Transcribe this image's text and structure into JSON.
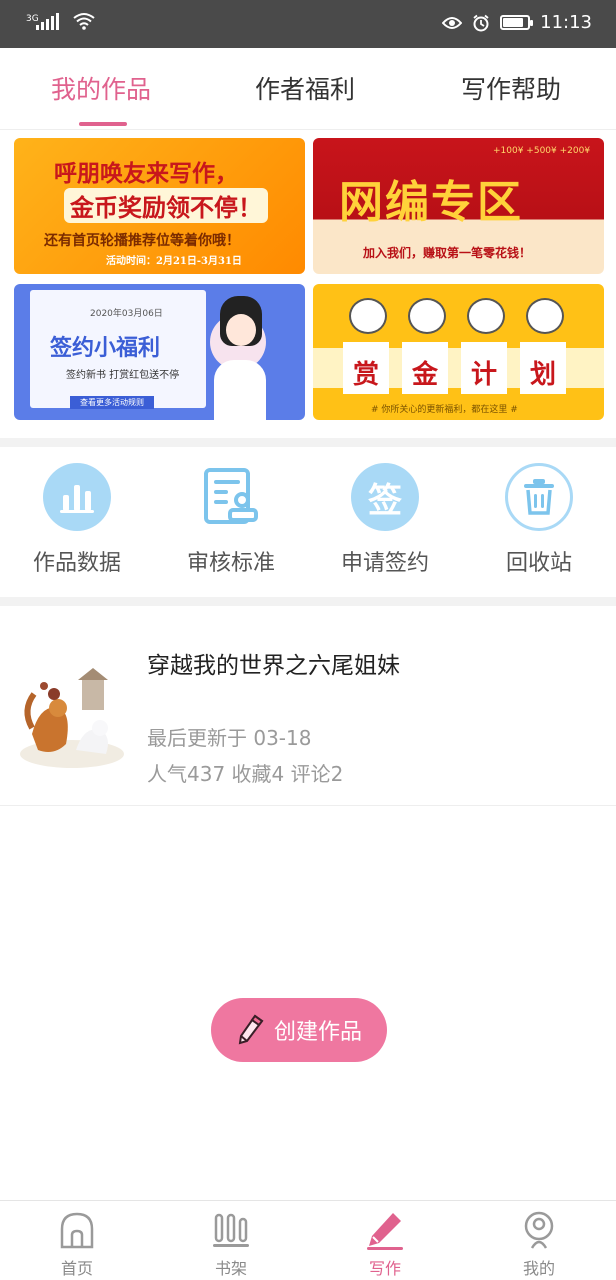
{
  "status_bar": {
    "network": "3G",
    "time": "11:13",
    "battery_level": 0.85
  },
  "tabs": [
    {
      "label": "我的作品",
      "active": true
    },
    {
      "label": "作者福利",
      "active": false
    },
    {
      "label": "写作帮助",
      "active": false
    }
  ],
  "banners": [
    {
      "line1": "呼朋唤友来写作，",
      "line2": "金币奖励领不停！",
      "line3": "还有首页轮播推荐位等着你哦！",
      "note": "活动时间：2月21日-3月31日"
    },
    {
      "title": "网编专区",
      "note": "加入我们，赚取第一笔零花钱！",
      "tags": "+100¥  +500¥  +200¥"
    },
    {
      "date": "2020年03月06日",
      "title": "签约小福利",
      "sub": "签约新书  打赏红包送不停",
      "link": "查看更多活动规则"
    },
    {
      "chars": [
        "赏",
        "金",
        "计",
        "划"
      ],
      "note": "# 你所关心的更新福利，都在这里 #"
    }
  ],
  "tools": [
    {
      "label": "作品数据",
      "icon": "bar-chart-icon"
    },
    {
      "label": "审核标准",
      "icon": "review-doc-icon"
    },
    {
      "label": "申请签约",
      "icon": "sign-icon"
    },
    {
      "label": "回收站",
      "icon": "trash-icon"
    }
  ],
  "tool_sign_glyph": "签",
  "work": {
    "title": "穿越我的世界之六尾姐妹",
    "updated": "最后更新于 03-18",
    "stats": "人气437  收藏4  评论2"
  },
  "create_button": {
    "label": "创建作品"
  },
  "bottom_nav": [
    {
      "label": "首页",
      "icon": "home-icon",
      "active": false
    },
    {
      "label": "书架",
      "icon": "bookshelf-icon",
      "active": false
    },
    {
      "label": "写作",
      "icon": "pen-icon",
      "active": true
    },
    {
      "label": "我的",
      "icon": "profile-icon",
      "active": false
    }
  ],
  "colors": {
    "accent": "#e0628e",
    "create_button": "#ef77a0",
    "tool_icon_bg": "#a9d9f6"
  }
}
